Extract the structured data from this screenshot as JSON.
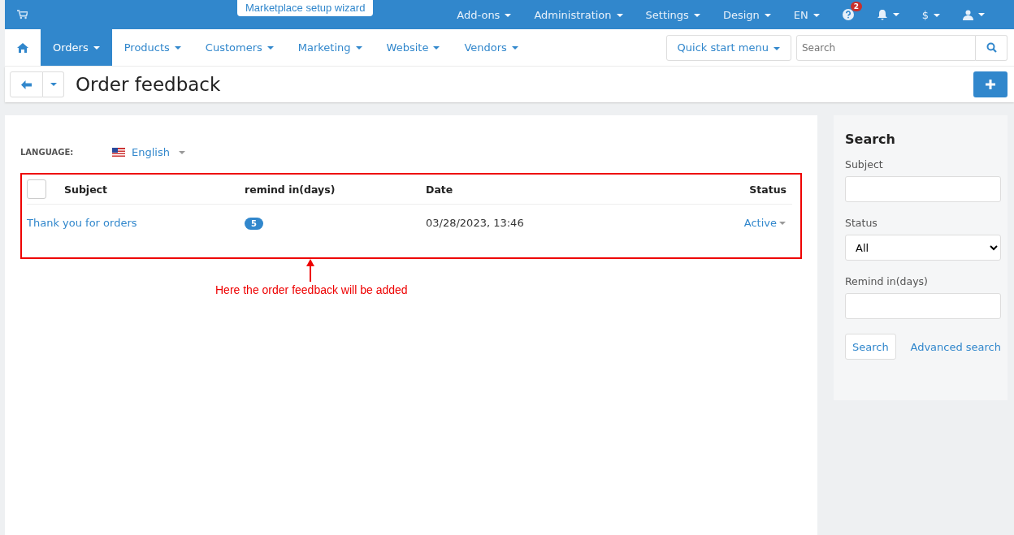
{
  "top_bar": {
    "wizard_button": "Marketplace setup wizard",
    "menus": [
      "Add-ons",
      "Administration",
      "Settings",
      "Design",
      "EN"
    ],
    "help_badge": "2",
    "currency": "$"
  },
  "nav": {
    "tabs": [
      {
        "label": "Orders",
        "selected": true
      },
      {
        "label": "Products",
        "selected": false
      },
      {
        "label": "Customers",
        "selected": false
      },
      {
        "label": "Marketing",
        "selected": false
      },
      {
        "label": "Website",
        "selected": false
      },
      {
        "label": "Vendors",
        "selected": false
      }
    ],
    "quick_start": "Quick start menu",
    "search": {
      "placeholder": "Search"
    }
  },
  "page_title": "Order feedback",
  "language": {
    "label": "LANGUAGE:",
    "value": "English"
  },
  "table": {
    "select_all_checked": false,
    "columns": [
      "Subject",
      "remind in(days)",
      "Date",
      "Status"
    ],
    "rows": [
      {
        "subject": "Thank you for orders",
        "remind": "5",
        "date": "03/28/2023, 13:46",
        "status": "Active"
      }
    ]
  },
  "annotation": "Here the order feedback will be added",
  "sidebar": {
    "title": "Search",
    "fields": [
      {
        "label": "Subject",
        "kind": "text"
      },
      {
        "label": "Status",
        "kind": "select",
        "value": "All"
      },
      {
        "label": "Remind in(days)",
        "kind": "text"
      }
    ],
    "search_button": "Search",
    "advanced_link": "Advanced search"
  }
}
